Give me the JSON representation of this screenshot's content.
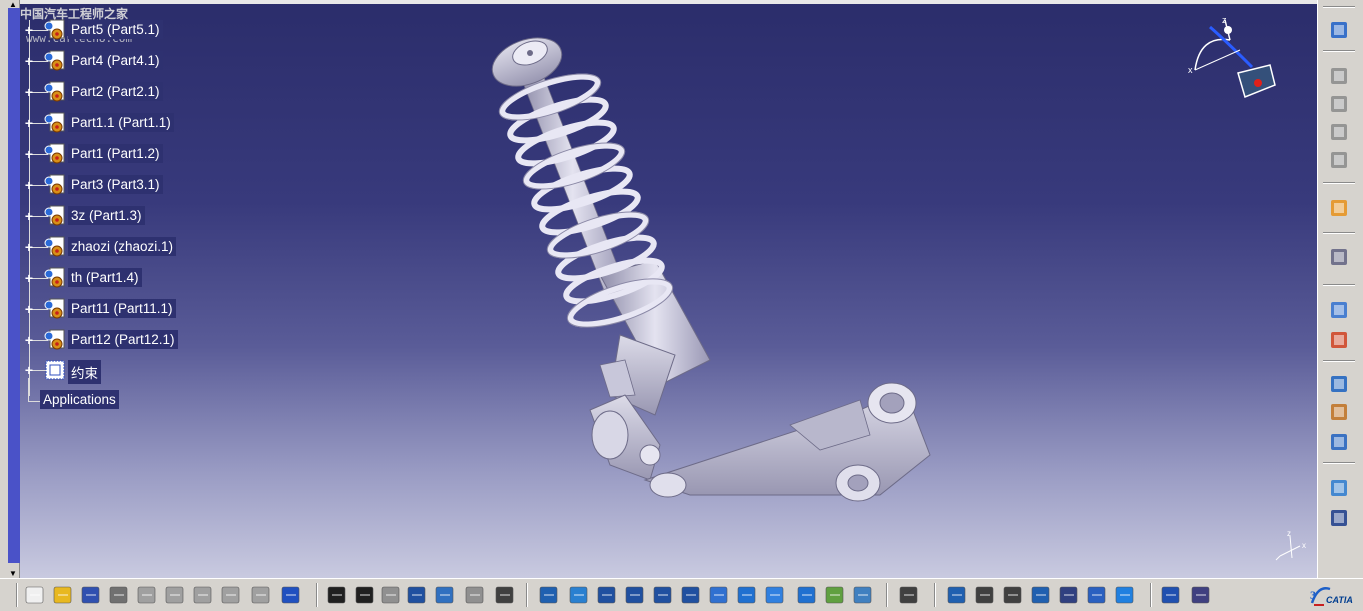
{
  "tree": {
    "nodes": [
      {
        "label": "Part5 (Part5.1)"
      },
      {
        "label": "Part4 (Part4.1)"
      },
      {
        "label": "Part2 (Part2.1)"
      },
      {
        "label": "Part1.1 (Part1.1)"
      },
      {
        "label": "Part1 (Part1.2)"
      },
      {
        "label": "Part3 (Part3.1)"
      },
      {
        "label": "3z (Part1.3)"
      },
      {
        "label": "zhaozi (zhaozi.1)"
      },
      {
        "label": "th (Part1.4)"
      },
      {
        "label": "Part11 (Part11.1)"
      },
      {
        "label": "Part12 (Part12.1)"
      },
      {
        "label": "约束"
      }
    ],
    "applications": "Applications"
  },
  "watermark": {
    "line1": "中国汽车工程师之家",
    "line2": "www.cartech8.com"
  },
  "brand": {
    "logo_text": "CATIA"
  },
  "compass": {
    "x_label": "x",
    "z_label": "z"
  },
  "axis_mini": {
    "z_label": "z",
    "x_label": "x"
  },
  "icons": {
    "right_toolbar": [
      "sketcher-icon",
      "product-structure-icon",
      "new-component-icon",
      "new-product-icon",
      "new-part-icon",
      "select-icon",
      "fast-multi-instantiation-icon",
      "manipulation-icon",
      "snap-icon",
      "constraint-icon",
      "update-icon",
      "scenes-icon",
      "catalog-icon",
      "analysis-icon"
    ],
    "bottom_toolbar": [
      "new-icon",
      "open-icon",
      "save-icon",
      "print-icon",
      "cut-icon",
      "copy-icon",
      "paste-icon",
      "undo-icon",
      "redo-icon",
      "whats-this-icon",
      "formula-icon",
      "comment-icon",
      "link-icon",
      "table-icon",
      "tree-icon",
      "lock-icon",
      "macro-icon",
      "fly-mode-icon",
      "fit-all-icon",
      "pan-icon",
      "rotate-icon",
      "zoom-in-icon",
      "zoom-out-icon",
      "normal-view-icon",
      "multi-view-icon",
      "iso-view-icon",
      "shading-icon",
      "material-icon",
      "render-icon",
      "capture-icon",
      "measure-icon",
      "begin-icon",
      "end-icon",
      "search-icon",
      "explode-icon",
      "clash-icon",
      "sectioning-icon",
      "ruler-icon",
      "publish-icon"
    ]
  }
}
